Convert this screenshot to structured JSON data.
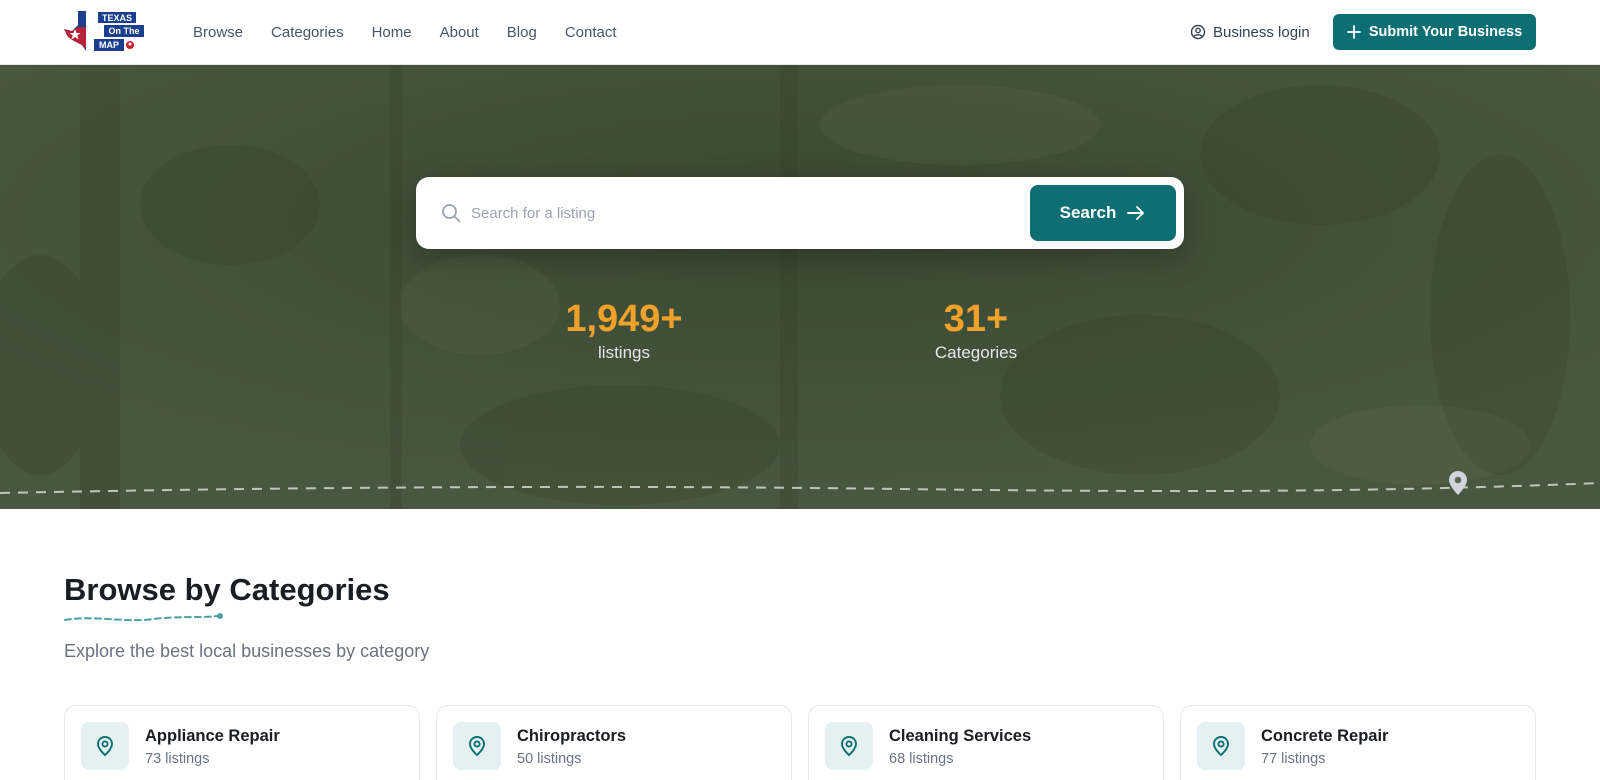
{
  "logo": {
    "line1": "TEXAS",
    "line2": "On The",
    "line3": "MAP"
  },
  "nav": {
    "links": [
      "Browse",
      "Categories",
      "Home",
      "About",
      "Blog",
      "Contact"
    ],
    "business_login": "Business login",
    "submit_label": "Submit Your Business"
  },
  "hero": {
    "search_placeholder": "Search for a listing",
    "search_button": "Search",
    "stats": [
      {
        "value": "1,949+",
        "label": "listings"
      },
      {
        "value": "31+",
        "label": "Categories"
      }
    ]
  },
  "categories": {
    "title": "Browse by Categories",
    "subtitle": "Explore the best local businesses by category",
    "items": [
      {
        "name": "Appliance Repair",
        "count": "73 listings"
      },
      {
        "name": "Chiropractors",
        "count": "50 listings"
      },
      {
        "name": "Cleaning Services",
        "count": "68 listings"
      },
      {
        "name": "Concrete Repair",
        "count": "77 listings"
      }
    ]
  },
  "colors": {
    "brand": "#0d6e73",
    "accent": "#f0a12a",
    "hero_bg": "#40503a"
  },
  "icons": {
    "search": "search-icon",
    "arrow": "arrow-right-icon",
    "user": "user-circle-icon",
    "plus": "plus-icon",
    "pin": "map-pin-icon"
  }
}
